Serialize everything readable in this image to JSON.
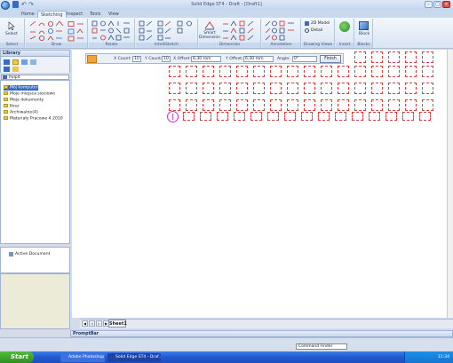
{
  "window": {
    "title": "Solid Edge ST4 - Draft - [Draft1]"
  },
  "quick_access": {
    "undo": "↶",
    "redo": "↷"
  },
  "ribbon_tabs": [
    {
      "label": "Home",
      "active": false
    },
    {
      "label": "Sketching",
      "active": true
    },
    {
      "label": "Inspect",
      "active": false
    },
    {
      "label": "Tools",
      "active": false
    },
    {
      "label": "View",
      "active": false
    }
  ],
  "ribbon": {
    "select_label": "Select",
    "groups": [
      "Select",
      "Draw",
      "Relate",
      "IntelliSketch",
      "Dimension",
      "Annotation",
      "Drawing Views",
      "Insert",
      "Blocks"
    ],
    "smart_dimension_label": "Smart\nDimension",
    "model_2d_label": "2D Model",
    "detail_label": "Detail",
    "block_label": "Block"
  },
  "library": {
    "title": "Library",
    "path": "Pulpit",
    "items": [
      {
        "label": "Mój komputer",
        "selected": true
      },
      {
        "label": "Moje miejsca sieciowe",
        "selected": false
      },
      {
        "label": "Moje dokumenty",
        "selected": false
      },
      {
        "label": "Kosz",
        "selected": false
      },
      {
        "label": "Archiwalne(4)",
        "selected": false
      },
      {
        "label": "Materiały Pracowe 4 2010",
        "selected": false
      }
    ],
    "active_document": "Active Document"
  },
  "command_bar": {
    "x_count_label": "X Count:",
    "x_count_value": "10",
    "y_count_label": "Y Count:",
    "y_count_value": "10",
    "x_offset_label": "X Offset:",
    "x_offset_value": "6,30 mm",
    "y_offset_label": "Y Offset:",
    "y_offset_value": "6,30 mm",
    "angle_label": "Angle:",
    "angle_value": "0°",
    "finish_label": "Finish"
  },
  "sheet": {
    "tab_label": "Sheet1"
  },
  "prompt": {
    "title": "PromptBar"
  },
  "status": {
    "command_finder": "Command Finder"
  },
  "taskbar": {
    "start": "Start",
    "tasks": [
      "Adobe Photoshop",
      "Solid Edge ST4 - Draf..."
    ],
    "clock": "11:34"
  },
  "colors": {
    "accent": "#f2a436",
    "pattern_red": "#e3393f",
    "origin_magenta": "#d52ad5"
  }
}
